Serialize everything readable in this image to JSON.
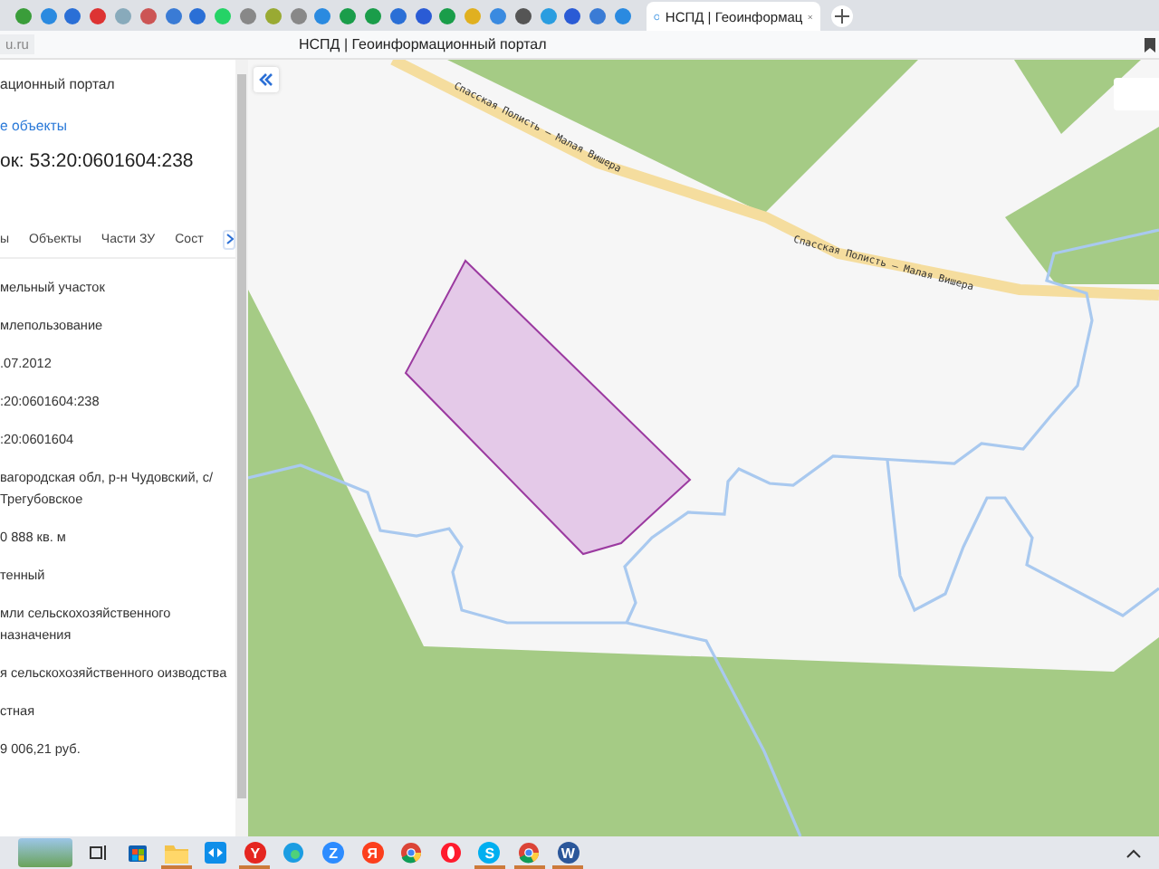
{
  "browser": {
    "active_tab": {
      "title": "НСПД | Геоинформац"
    },
    "address": "u.ru",
    "page_title": "НСПД | Геоинформационный портал"
  },
  "panel": {
    "portal_title": "ационный портал",
    "link": "е объекты",
    "heading": "ок: 53:20:0601604:238",
    "tabs": [
      {
        "label": "ы",
        "selected": false
      },
      {
        "label": "Объекты",
        "selected": false
      },
      {
        "label": "Части ЗУ",
        "selected": false
      },
      {
        "label": "Сост",
        "selected": false
      }
    ],
    "fields": [
      "мельный участок",
      "млепользование",
      ".07.2012",
      ":20:0601604:238",
      ":20:0601604",
      "вагородская обл, р-н Чудовский, с/ Трегубовское",
      "0 888 кв. м",
      "тенный",
      "мли сельскохозяйственного назначения",
      "я сельскохозяйственного оизводства",
      "стная",
      "9 006,21 руб."
    ]
  },
  "map": {
    "road_labels": [
      "Спасская Полисть – Малая Вишера",
      "Спасская Полисть – Малая Вишера"
    ]
  },
  "taskbar": [
    {
      "kind": "photo"
    },
    {
      "kind": "taskview",
      "running": false
    },
    {
      "kind": "store",
      "running": false
    },
    {
      "kind": "folder",
      "running": true
    },
    {
      "kind": "remote",
      "running": false
    },
    {
      "kind": "letter",
      "glyph": "Y",
      "color": "#e52620",
      "running": true
    },
    {
      "kind": "edge",
      "running": false
    },
    {
      "kind": "letter",
      "glyph": "Z",
      "color": "#2d8cff",
      "running": false
    },
    {
      "kind": "letter",
      "glyph": "Я",
      "color": "#fc3f1d",
      "running": false
    },
    {
      "kind": "chrome",
      "running": false
    },
    {
      "kind": "opera",
      "running": false
    },
    {
      "kind": "letter",
      "glyph": "S",
      "color": "#00aff0",
      "running": true
    },
    {
      "kind": "chrome",
      "running": true
    },
    {
      "kind": "letter",
      "glyph": "W",
      "color": "#2b579a",
      "running": true
    }
  ]
}
